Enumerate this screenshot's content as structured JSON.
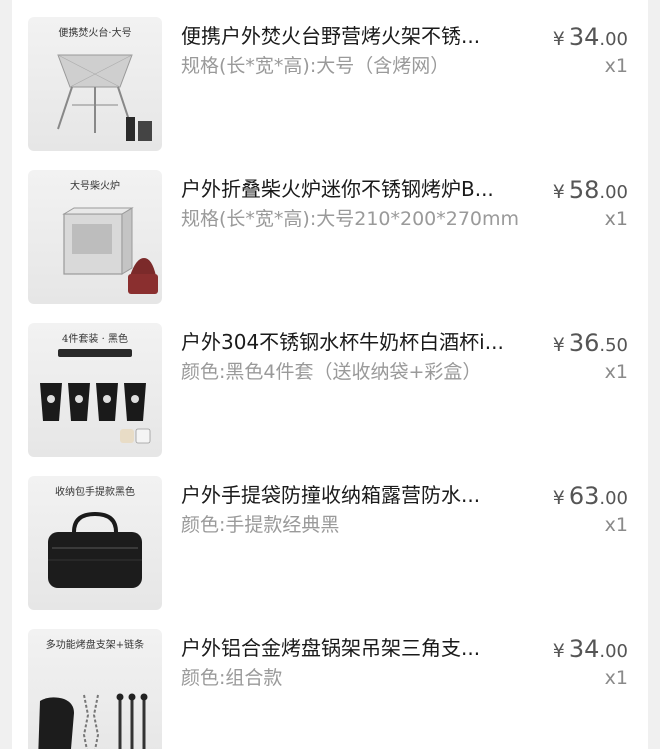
{
  "currency": "¥",
  "items": [
    {
      "image_caption": "便携焚火台·大号",
      "title": "便携户外焚火台野营烤火架不锈...",
      "spec": "规格(长*宽*高):大号（含烤网）",
      "price_int": "34",
      "price_dec": ".00",
      "qty": "x1"
    },
    {
      "image_caption": "大号柴火炉",
      "title": "户外折叠柴火炉迷你不锈钢烤炉B...",
      "spec": "规格(长*宽*高):大号210*200*270mm",
      "price_int": "58",
      "price_dec": ".00",
      "qty": "x1"
    },
    {
      "image_caption": "4件套装 · 黑色",
      "title": "户外304不锈钢水杯牛奶杯白酒杯i...",
      "spec": "颜色:黑色4件套（送收纳袋+彩盒）",
      "price_int": "36",
      "price_dec": ".50",
      "qty": "x1"
    },
    {
      "image_caption": "收纳包手提款黑色",
      "title": "户外手提袋防撞收纳箱露营防水...",
      "spec": "颜色:手提款经典黑",
      "price_int": "63",
      "price_dec": ".00",
      "qty": "x1"
    },
    {
      "image_caption": "多功能烤盘支架+链条",
      "title": "户外铝合金烤盘锅架吊架三角支...",
      "spec": "颜色:组合款",
      "price_int": "34",
      "price_dec": ".00",
      "qty": "x1"
    }
  ]
}
